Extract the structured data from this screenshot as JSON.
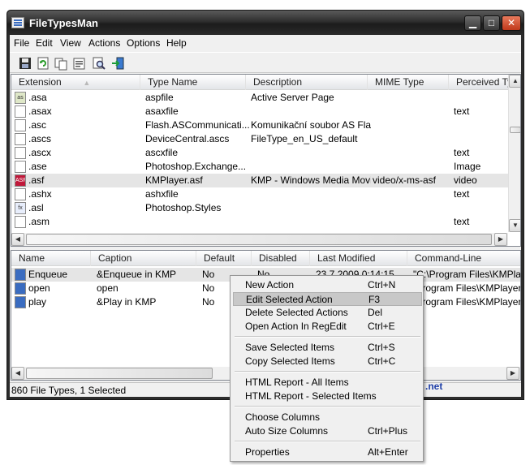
{
  "window": {
    "title": "FileTypesMan"
  },
  "menubar": {
    "items": [
      "File",
      "Edit",
      "View",
      "Actions",
      "Options",
      "Help"
    ]
  },
  "toolbar": {
    "buttons": [
      "save-icon",
      "refresh-icon",
      "copy-icon",
      "properties-icon",
      "find-icon",
      "exit-icon"
    ]
  },
  "types_table": {
    "columns": [
      "Extension",
      "Type Name",
      "Description",
      "MIME Type",
      "Perceived Typ"
    ],
    "rows": [
      {
        "ext": ".asa",
        "icon": "as",
        "type": "aspfile",
        "desc": "Active Server Page",
        "mime": "",
        "perc": ""
      },
      {
        "ext": ".asax",
        "icon": "",
        "type": "asaxfile",
        "desc": "",
        "mime": "",
        "perc": "text"
      },
      {
        "ext": ".asc",
        "icon": "",
        "type": "Flash.ASCommunicati...",
        "desc": "Komunikační soubor AS Flash",
        "mime": "",
        "perc": ""
      },
      {
        "ext": ".ascs",
        "icon": "",
        "type": "DeviceCentral.ascs",
        "desc": "FileType_en_US_default",
        "mime": "",
        "perc": ""
      },
      {
        "ext": ".ascx",
        "icon": "",
        "type": "ascxfile",
        "desc": "",
        "mime": "",
        "perc": "text"
      },
      {
        "ext": ".ase",
        "icon": "",
        "type": "Photoshop.Exchange...",
        "desc": "",
        "mime": "",
        "perc": "Image"
      },
      {
        "ext": ".asf",
        "icon": "ASF",
        "type": "KMPlayer.asf",
        "desc": "KMP - Windows Media Movie",
        "mime": "video/x-ms-asf",
        "perc": "video"
      },
      {
        "ext": ".ashx",
        "icon": "",
        "type": "ashxfile",
        "desc": "",
        "mime": "",
        "perc": "text"
      },
      {
        "ext": ".asl",
        "icon": "fx",
        "type": "Photoshop.Styles",
        "desc": "",
        "mime": "",
        "perc": ""
      },
      {
        "ext": ".asm",
        "icon": "",
        "type": "",
        "desc": "",
        "mime": "",
        "perc": "text"
      }
    ]
  },
  "actions_table": {
    "columns": [
      "Name",
      "Caption",
      "Default",
      "Disabled",
      "Last Modified",
      "Command-Line"
    ],
    "rows": [
      {
        "name": "Enqueue",
        "caption": "&Enqueue in KMP",
        "default": "No",
        "disabled": "No",
        "modified": "23.7.2009 0:14:15",
        "cmd": "\"C:\\Program Files\\KMPlayer\\"
      },
      {
        "name": "open",
        "caption": "open",
        "default": "No",
        "disabled": "",
        "modified": "",
        "cmd": "\\Program Files\\KMPlayer\\"
      },
      {
        "name": "play",
        "caption": "&Play in KMP",
        "default": "No",
        "disabled": "",
        "modified": "",
        "cmd": "\\Program Files\\KMPlayer\\"
      }
    ]
  },
  "status": {
    "left": "860 File Types, 1 Selected",
    "right": ".net"
  },
  "context_menu": {
    "groups": [
      [
        {
          "label": "New Action",
          "key": "Ctrl+N"
        },
        {
          "label": "Edit Selected Action",
          "key": "F3"
        },
        {
          "label": "Delete Selected Actions",
          "key": "Del"
        },
        {
          "label": "Open Action In RegEdit",
          "key": "Ctrl+E"
        }
      ],
      [
        {
          "label": "Save Selected Items",
          "key": "Ctrl+S"
        },
        {
          "label": "Copy Selected Items",
          "key": "Ctrl+C"
        }
      ],
      [
        {
          "label": "HTML Report - All Items",
          "key": ""
        },
        {
          "label": "HTML Report - Selected Items",
          "key": ""
        }
      ],
      [
        {
          "label": "Choose Columns",
          "key": ""
        },
        {
          "label": "Auto Size Columns",
          "key": "Ctrl+Plus"
        }
      ],
      [
        {
          "label": "Properties",
          "key": "Alt+Enter"
        }
      ]
    ],
    "highlighted": "Edit Selected Action"
  }
}
